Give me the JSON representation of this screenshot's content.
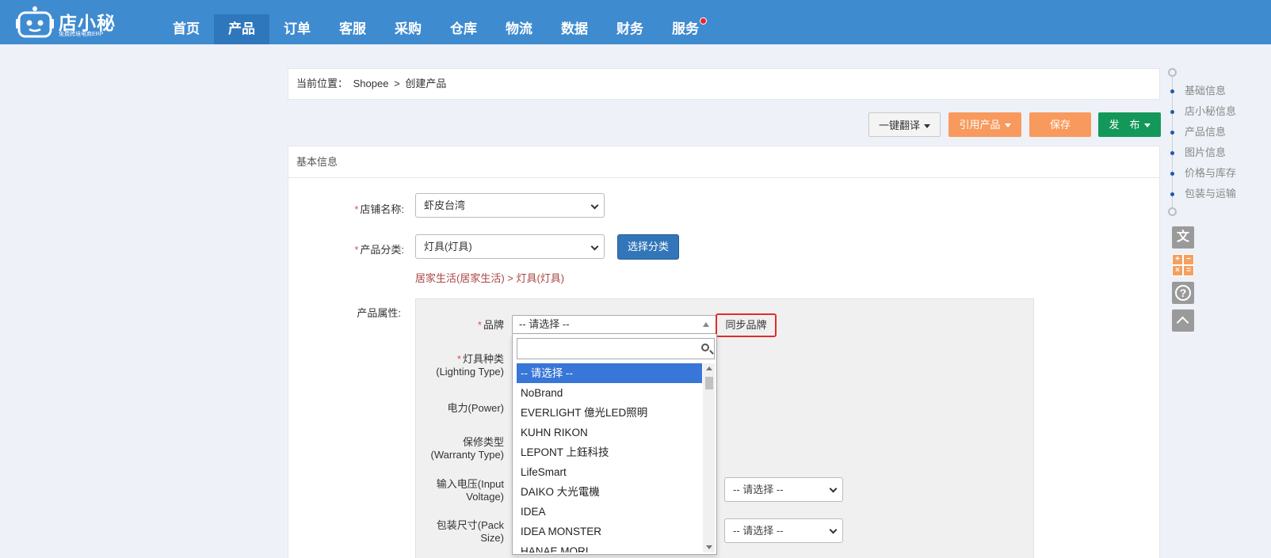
{
  "app": {
    "logo_title": "店小秘",
    "logo_subtitle": "免费跨境电商ERP"
  },
  "nav": {
    "items": [
      "首页",
      "产品",
      "订单",
      "客服",
      "采购",
      "仓库",
      "物流",
      "数据",
      "财务",
      "服务"
    ],
    "active": "产品"
  },
  "breadcrumb": {
    "prefix": "当前位置：",
    "platform": "Shopee",
    "separator": ">",
    "page": "创建产品"
  },
  "actions": {
    "translate": "一键翻译",
    "cite": "引用产品",
    "save": "保存",
    "publish": "发　布"
  },
  "section": {
    "title": "基本信息"
  },
  "form": {
    "shop_label": "店铺名称:",
    "shop_value": "虾皮台湾",
    "category_label": "产品分类:",
    "category_value": "灯具(灯具)",
    "choose_category": "选择分类",
    "category_path": "居家生活(居家生活) > 灯具(灯具)",
    "attributes_label": "产品属性:"
  },
  "attributes": {
    "brand_label": "品牌",
    "brand_value": "-- 请选择 --",
    "sync_brand": "同步品牌",
    "lighting_type_label": "灯具种类",
    "lighting_type_en": "(Lighting Type)",
    "power_label": "电力(Power)",
    "warranty_label": "保修类型",
    "warranty_en": "(Warranty Type)",
    "voltage_label_1": "输入电压(Input",
    "voltage_label_2": "Voltage)",
    "voltage_value": "-- 请选择 --",
    "pack_label_1": "包装尺寸(Pack",
    "pack_label_2": "Size)",
    "pack_value": "-- 请选择 --"
  },
  "brand_options": [
    "-- 请选择 --",
    "NoBrand",
    "EVERLIGHT 億光LED照明",
    "KUHN RIKON",
    "LEPONT 上鈺科技",
    "LifeSmart",
    "DAIKO 大光電機",
    "IDEA",
    "IDEA MONSTER",
    "HANAE MORI"
  ],
  "side_nav": {
    "items": [
      "基础信息",
      "店小秘信息",
      "产品信息",
      "图片信息",
      "价格与库存",
      "包装与运输"
    ]
  },
  "tools": {
    "translate_glyph": "文",
    "calc": [
      "+",
      "−",
      "×",
      "="
    ],
    "help_glyph": "?"
  },
  "colors": {
    "topbar": "#3f8bd0",
    "active_nav": "#2f77bc",
    "orange": "#f89a5e",
    "green": "#14985a",
    "primary_blue": "#3276b9",
    "highlight_red": "#e02d2d"
  }
}
